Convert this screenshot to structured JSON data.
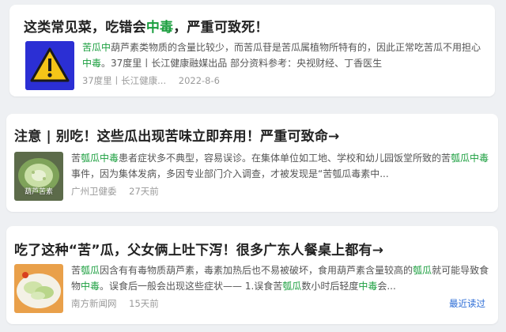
{
  "results": [
    {
      "title": "这类常见菜，吃错会中毒，严重可致死！",
      "title_parts": [
        {
          "text": "这类常见菜，吃错会",
          "hl": false
        },
        {
          "text": "中毒",
          "hl": true
        },
        {
          "text": "，严重可致死！",
          "hl": false
        }
      ],
      "thumb_icon": "warning-icon",
      "desc_parts": [
        {
          "text": "苦瓜中",
          "hl": true
        },
        {
          "text": "葫芦素类物质的含量比较少，而苦瓜苷是苦瓜属植物所特有的，因此正常吃苦瓜不用担心",
          "hl": false
        },
        {
          "text": "中毒",
          "hl": true
        },
        {
          "text": "。37度里丨长江健康融媒出品 部分资料参考：央视财经、丁香医生",
          "hl": false
        }
      ],
      "source": "37度里丨长江健康...",
      "date": "2022-8-6"
    },
    {
      "title": "注意 | 别吃！这些瓜出现苦味立即弃用！严重可致命→",
      "thumb_label": "葫芦苦素",
      "desc_parts": [
        {
          "text": "苦",
          "hl": false
        },
        {
          "text": "瓠瓜中毒",
          "hl": true
        },
        {
          "text": "患者症状多不典型，容易误诊。在集体单位如工地、学校和幼儿园饭堂所致的苦",
          "hl": false
        },
        {
          "text": "瓠瓜中毒",
          "hl": true
        },
        {
          "text": "事件，因为集体发病，多因专业部门介入调查，才被发现是“苦瓠瓜毒素中...",
          "hl": false
        }
      ],
      "source": "广州卫健委",
      "date": "27天前"
    },
    {
      "title": "吃了这种“苦”瓜，父女俩上吐下泻！很多广东人餐桌上都有→",
      "desc_parts": [
        {
          "text": "苦",
          "hl": false
        },
        {
          "text": "瓠瓜",
          "hl": true
        },
        {
          "text": "因含有有毒物质葫芦素，毒素加热后也不易被破坏，食用葫芦素含量较高的",
          "hl": false
        },
        {
          "text": "瓠瓜",
          "hl": true
        },
        {
          "text": "就可能导致食物",
          "hl": false
        },
        {
          "text": "中毒",
          "hl": true
        },
        {
          "text": "。误食后一般会出现这些症状—— 1.误食苦",
          "hl": false
        },
        {
          "text": "瓠瓜",
          "hl": true
        },
        {
          "text": "数小时后轻度",
          "hl": false
        },
        {
          "text": "中毒",
          "hl": true
        },
        {
          "text": "会...",
          "hl": false
        }
      ],
      "source": "南方新闻网",
      "date": "15天前",
      "recent_label": "最近读过"
    }
  ],
  "colors": {
    "highlight": "#1a9e3e",
    "link": "#2b6cd6",
    "meta": "#9a9a9a"
  }
}
